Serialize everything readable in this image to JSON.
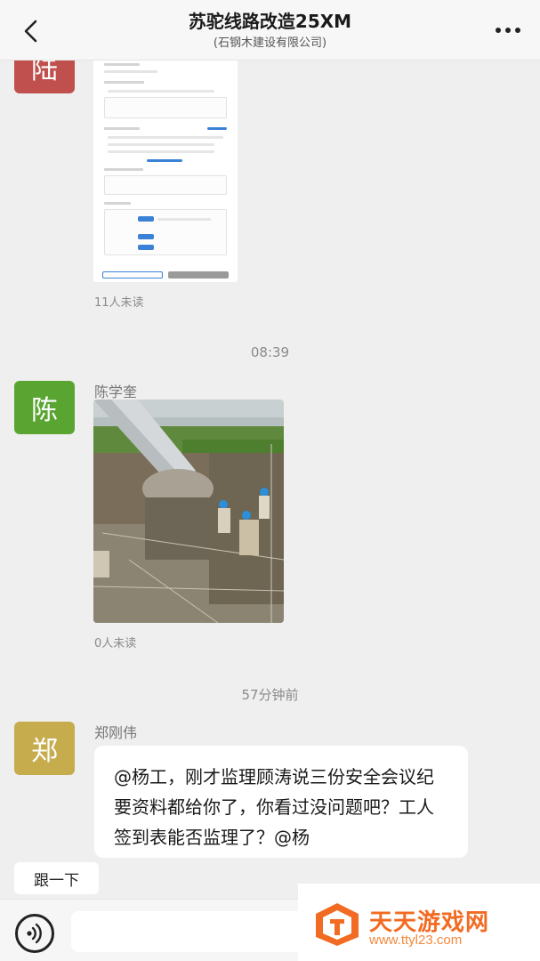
{
  "header": {
    "title": "苏驼线路改造25XM",
    "subtitle": "(石钢木建设有限公司)"
  },
  "messages": [
    {
      "avatar_text": "陆",
      "avatar_color": "#c0504d",
      "type": "form-image",
      "unread": "11人未读"
    },
    {
      "timestamp": "08:39"
    },
    {
      "avatar_text": "陈",
      "avatar_color": "#5aa532",
      "sender": "陈学奎",
      "type": "photo",
      "unread": "0人未读"
    },
    {
      "timestamp": "57分钟前"
    },
    {
      "avatar_text": "郑",
      "avatar_color": "#c7ac4e",
      "sender": "郑刚伟",
      "type": "text",
      "text": "@杨工，刚才监理顾涛说三份安全会议纪要资料都给你了，你看过没问题吧？工人签到表能否监理了？@杨"
    }
  ],
  "quick_reply": "跟一下",
  "watermark": {
    "title": "天天游戏网",
    "url": "www.ttyl23.com"
  },
  "icons": {
    "back": "chevron-left-icon",
    "more": "more-dots-icon",
    "voice": "voice-icon"
  }
}
